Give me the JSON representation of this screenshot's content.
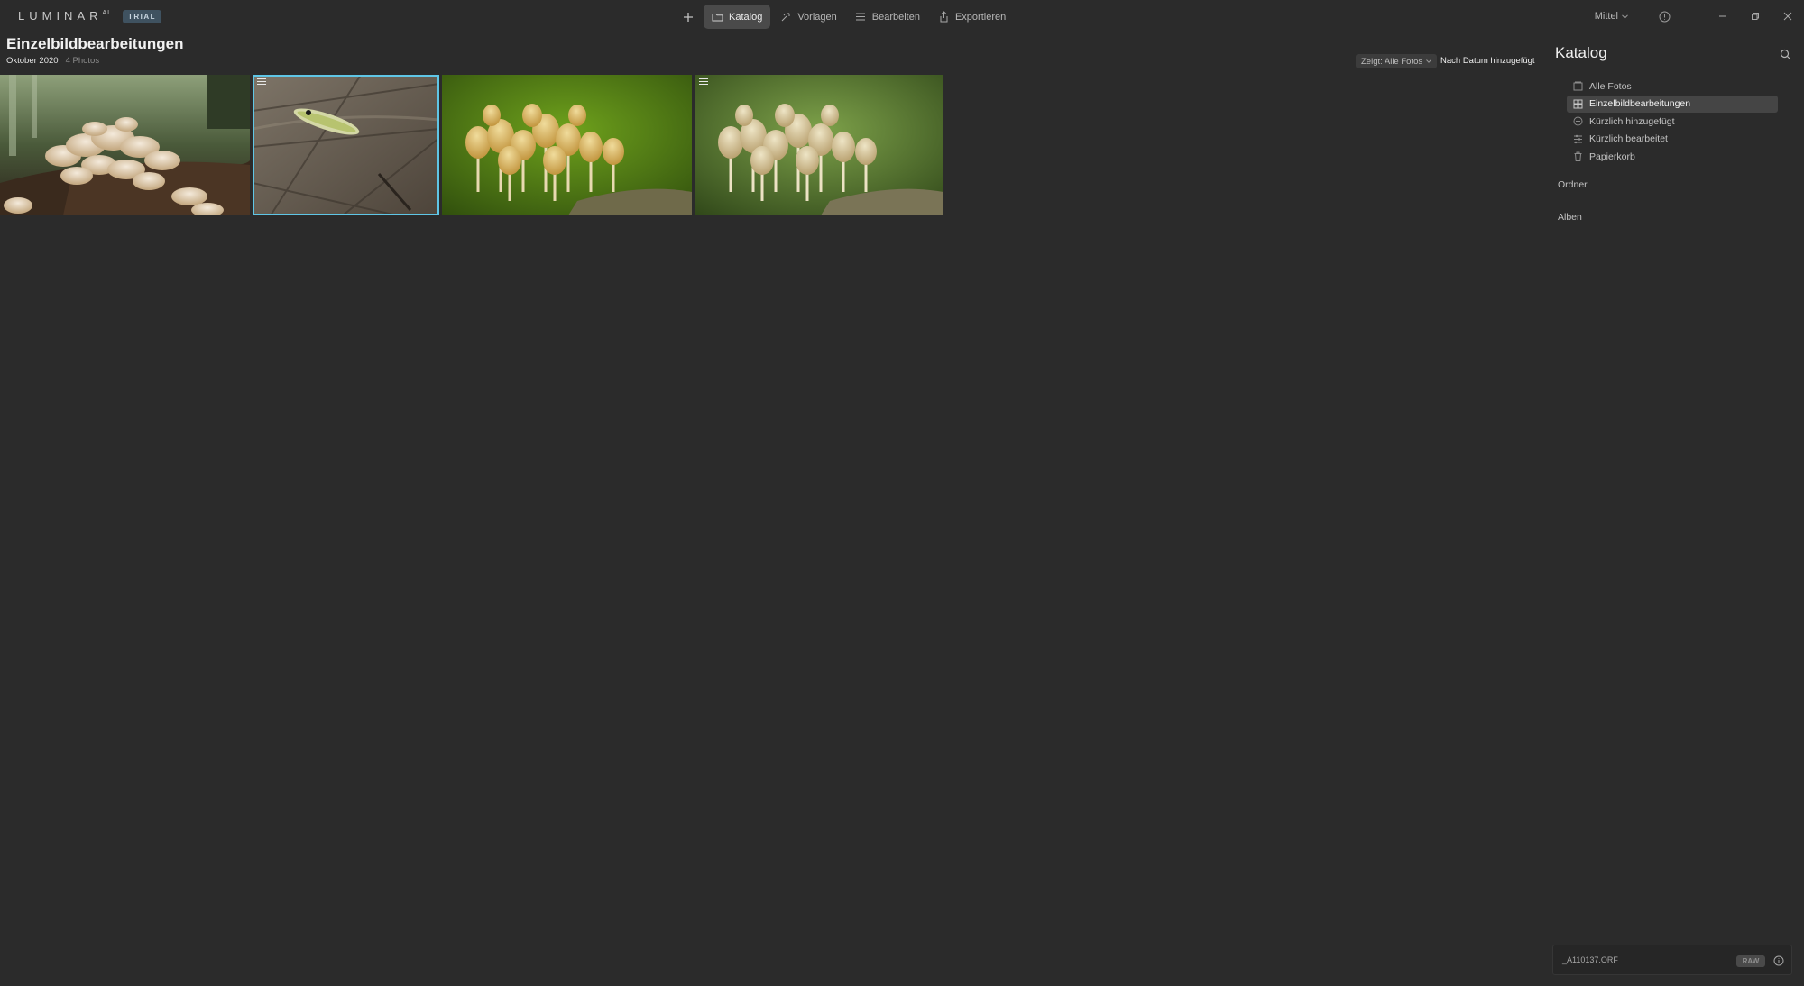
{
  "app": {
    "logo_text": "LUMINAR",
    "logo_sup": "AI",
    "badge": "TRIAL"
  },
  "nav": {
    "add_icon": "plus-icon",
    "tabs": [
      {
        "label": "Katalog",
        "icon": "folder-icon",
        "active": true
      },
      {
        "label": "Vorlagen",
        "icon": "sparkle-icon",
        "active": false
      },
      {
        "label": "Bearbeiten",
        "icon": "sliders-icon",
        "active": false
      },
      {
        "label": "Exportieren",
        "icon": "share-icon",
        "active": false
      }
    ]
  },
  "top_right": {
    "zoom": "Mittel",
    "window_buttons": [
      "minimize",
      "restore",
      "close"
    ]
  },
  "main": {
    "title": "Einzelbildbearbeitungen",
    "date": "Oktober 2020",
    "count": "4 Photos",
    "filter": "Zeigt: Alle Fotos",
    "sort": "Nach Datum hinzugefügt",
    "thumbnails": [
      {
        "subject": "mushroom cluster on log",
        "selected": false,
        "edited": false
      },
      {
        "subject": "caterpillar on bark",
        "selected": true,
        "edited": true
      },
      {
        "subject": "mushrooms in moss",
        "selected": false,
        "edited": false
      },
      {
        "subject": "mushrooms in moss edited",
        "selected": false,
        "edited": true
      }
    ]
  },
  "panel": {
    "title": "Katalog",
    "items": [
      {
        "label": "Alle Fotos",
        "icon": "photos-icon",
        "active": false
      },
      {
        "label": "Einzelbildbearbeitungen",
        "icon": "grid-icon",
        "active": true
      },
      {
        "label": "Kürzlich hinzugefügt",
        "icon": "clock-plus-icon",
        "active": false
      },
      {
        "label": "Kürzlich bearbeitet",
        "icon": "sliders-icon",
        "active": false
      },
      {
        "label": "Papierkorb",
        "icon": "trash-icon",
        "active": false
      }
    ],
    "folders": "Ordner",
    "albums": "Alben"
  },
  "info": {
    "filename": "_A110137.ORF",
    "format": "RAW"
  },
  "colors": {
    "background": "#2b2b2b",
    "selection": "#5fc6e6",
    "trial_badge": "#3f5260"
  }
}
